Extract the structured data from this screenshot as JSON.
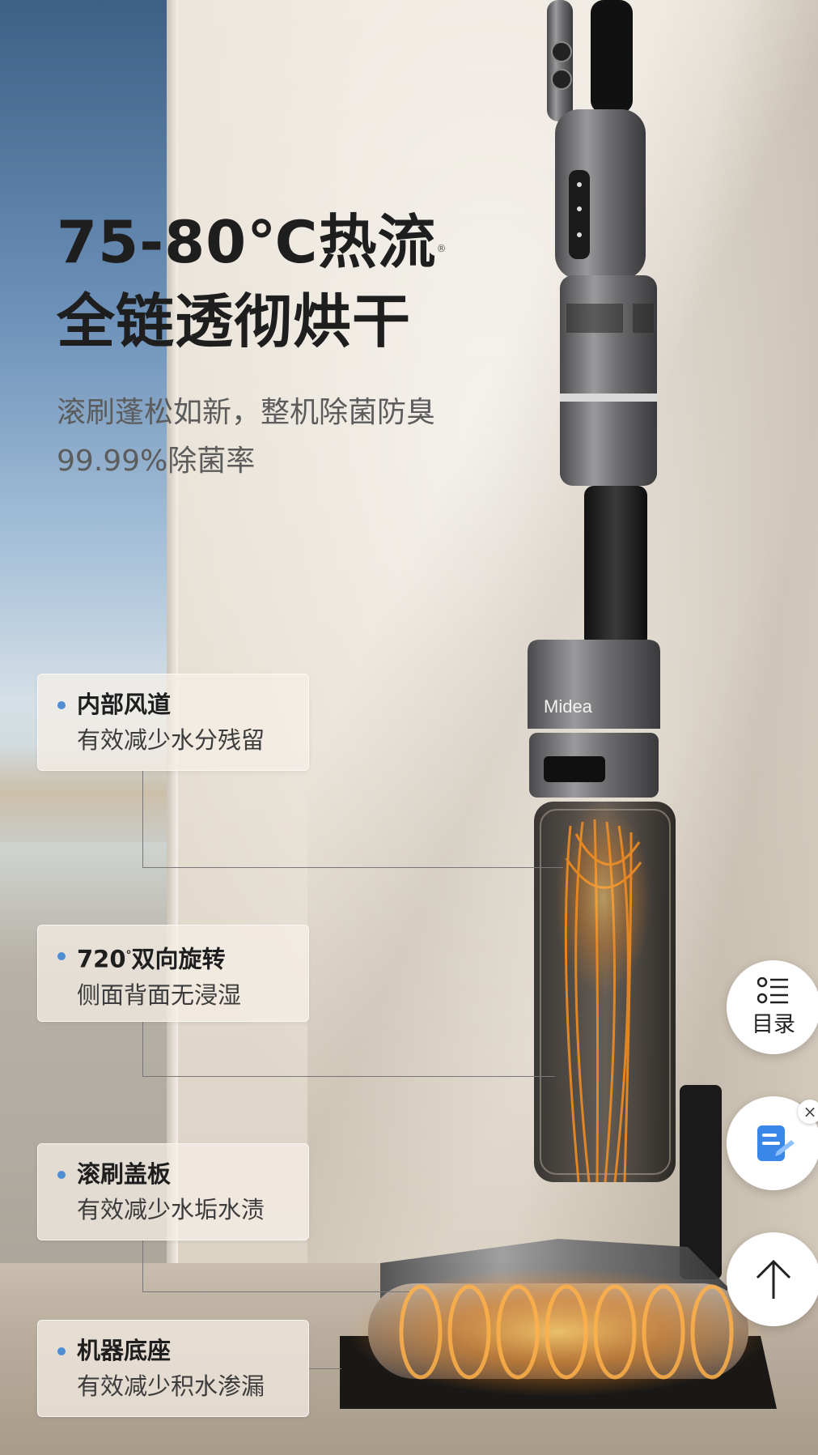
{
  "headline": {
    "line1": "75-80℃热流",
    "line1_mark": "®",
    "line2": "全链透彻烘干"
  },
  "subtext": {
    "line1": "滚刷蓬松如新，整机除菌防臭",
    "line2": "99.99%除菌率"
  },
  "brand_logo": "Midea",
  "features": [
    {
      "title": "内部风道",
      "desc": "有效减少水分残留"
    },
    {
      "title_num": "720",
      "title_deg": "°",
      "title_rest": "双向旋转",
      "desc": "侧面背面无浸湿"
    },
    {
      "title": "滚刷盖板",
      "desc": "有效减少水垢水渍"
    },
    {
      "title": "机器底座",
      "desc": "有效减少积水渗漏"
    }
  ],
  "side_buttons": {
    "toc_label": "目录",
    "toc_icon": "list-icon",
    "doc_icon": "document-icon",
    "close_icon": "close-icon",
    "close_glyph": "×",
    "top_icon": "arrow-up-icon"
  },
  "colors": {
    "accent_dot": "#4f8ed4",
    "heat_glow": "#f28a1e",
    "doc_button": "#3b87e8"
  }
}
